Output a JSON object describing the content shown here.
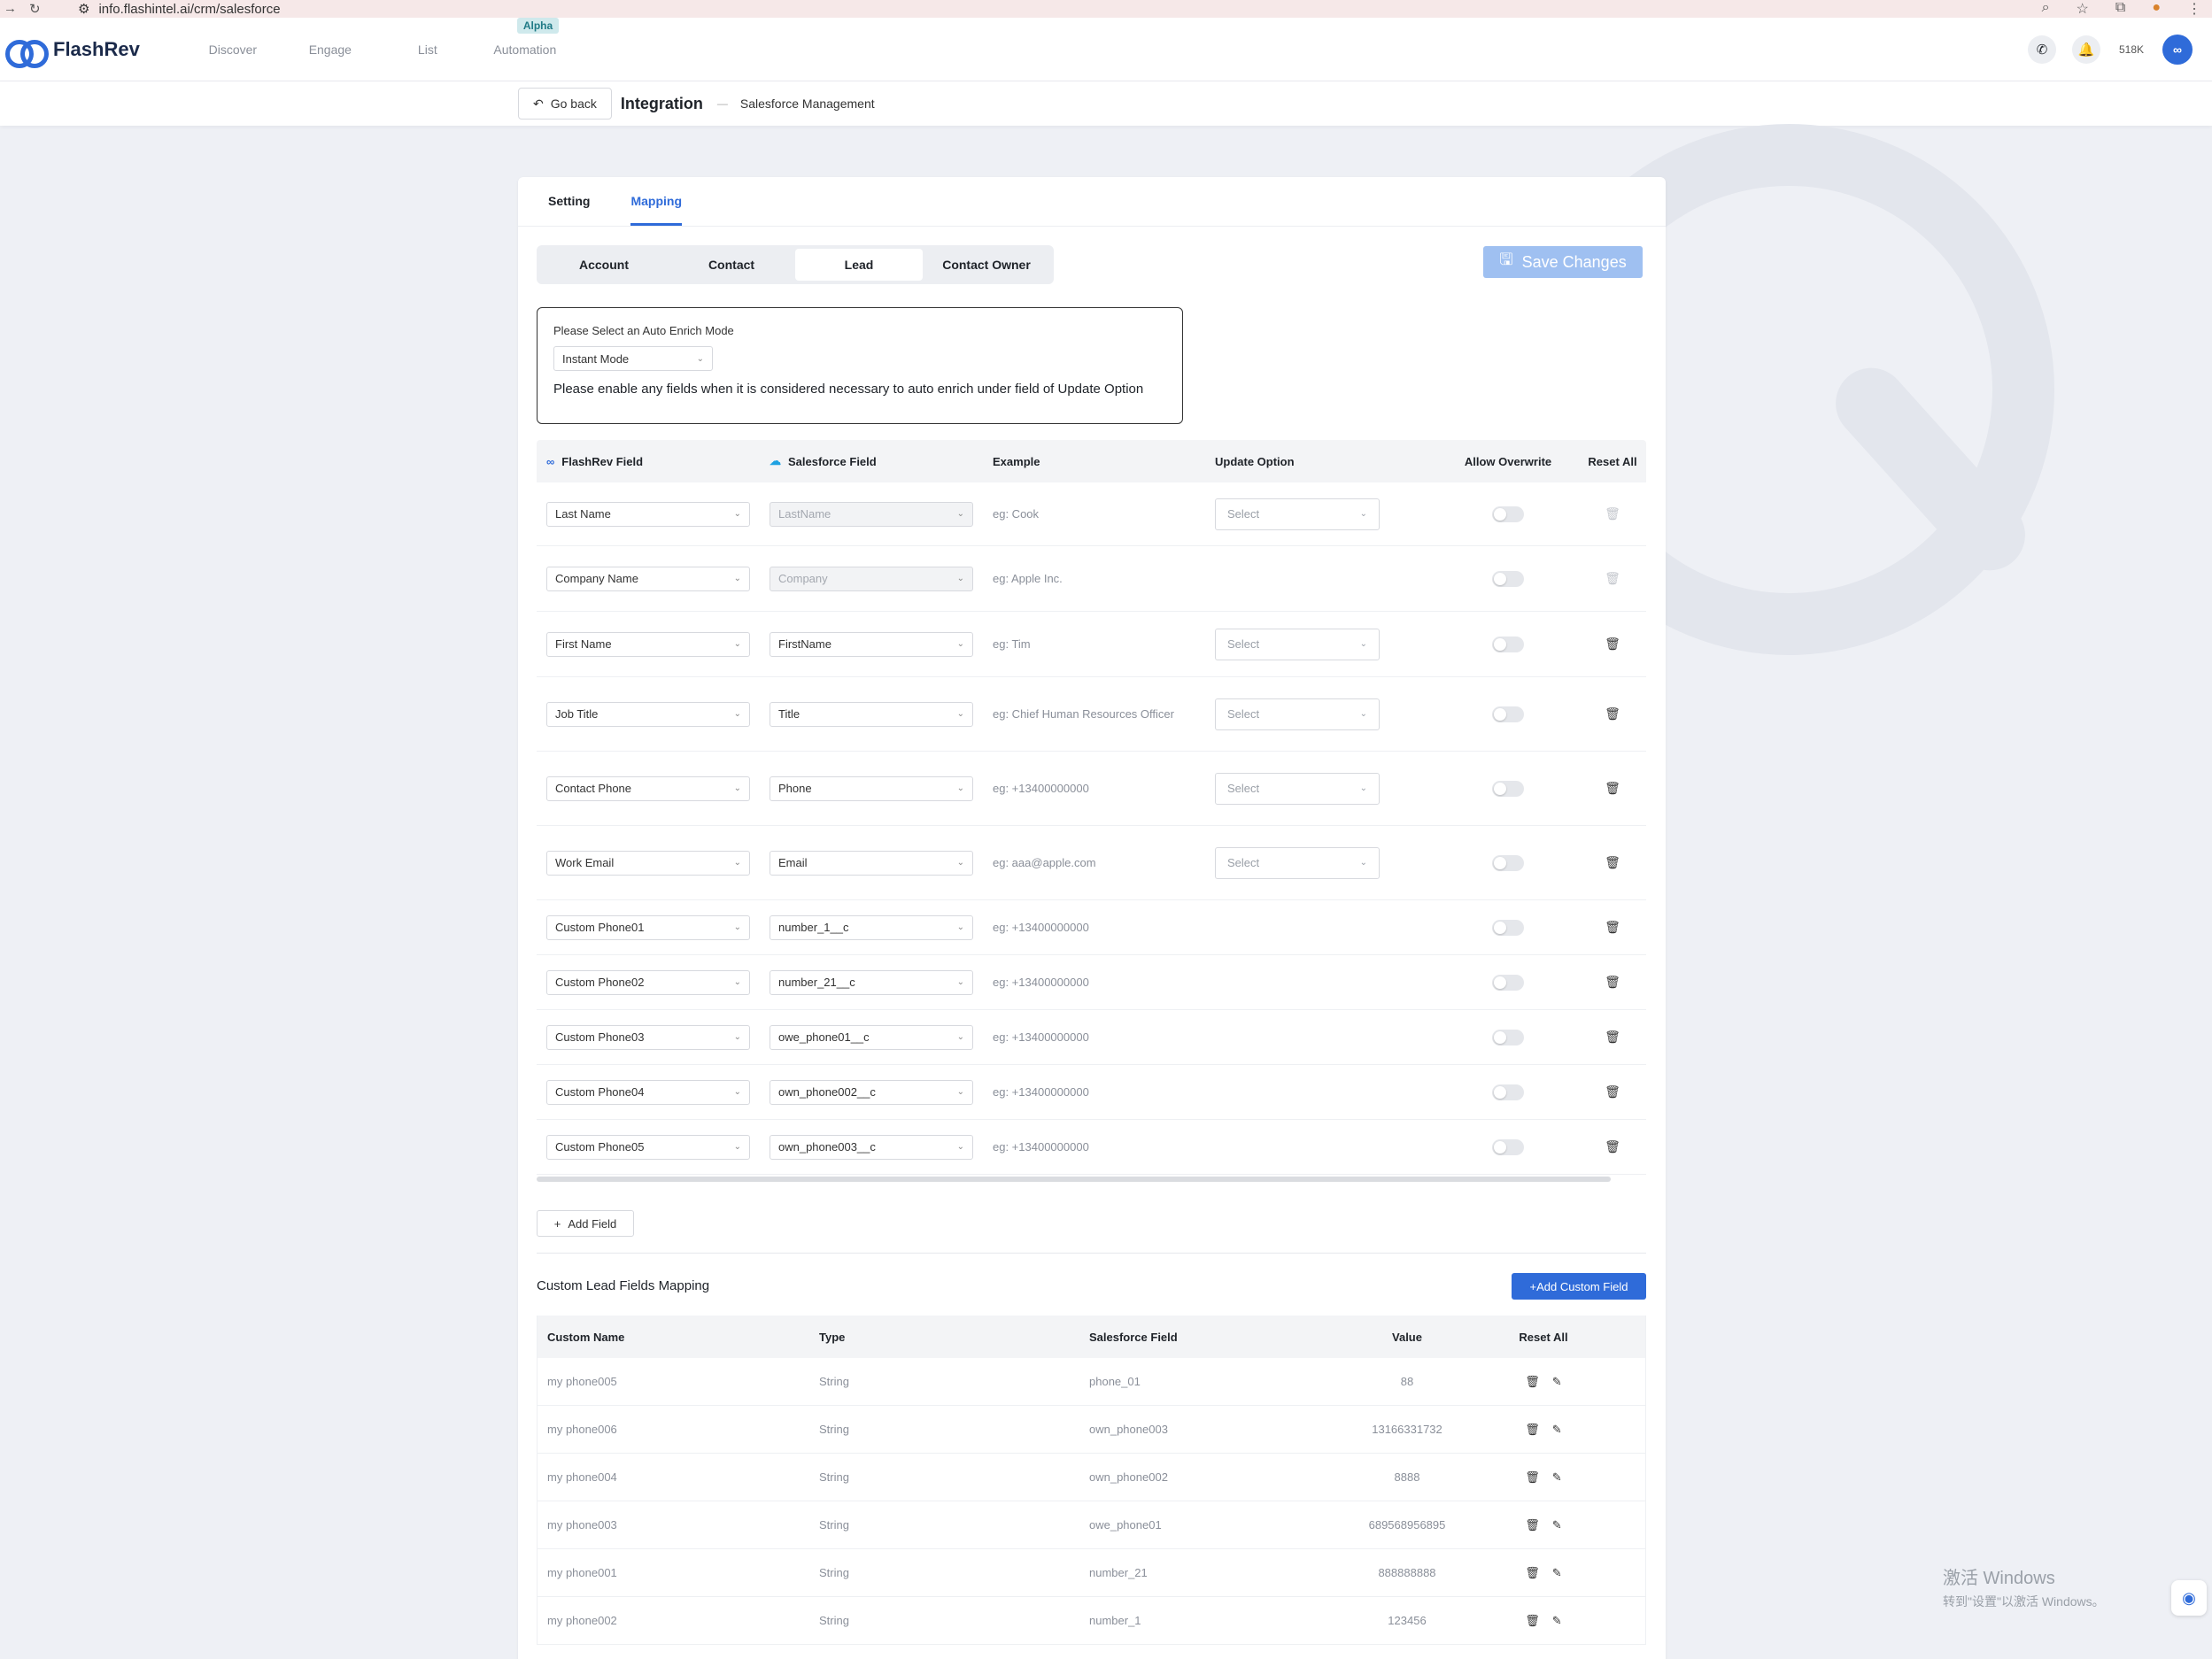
{
  "browser": {
    "url": "info.flashintel.ai/crm/salesforce"
  },
  "nav": {
    "brand": "FlashRev",
    "menu": [
      "Discover",
      "Engage",
      "List",
      "Automation"
    ],
    "alpha_badge": "Alpha",
    "credits": "518K"
  },
  "breadcrumb": {
    "go_back": "Go back",
    "title": "Integration",
    "sub": "Salesforce Management"
  },
  "tabs": [
    "Setting",
    "Mapping"
  ],
  "active_tab": "Mapping",
  "segments": [
    "Account",
    "Contact",
    "Lead",
    "Contact Owner"
  ],
  "active_segment": "Lead",
  "save_label": "Save Changes",
  "enrich": {
    "label": "Please Select an Auto Enrich Mode",
    "mode": "Instant Mode",
    "note": "Please enable any fields when it is considered necessary to auto enrich under field of Update Option"
  },
  "mapping": {
    "headers": {
      "flashrev": "FlashRev Field",
      "salesforce": "Salesforce Field",
      "example": "Example",
      "update": "Update Option",
      "overwrite": "Allow Overwrite",
      "reset": "Reset All"
    },
    "select_placeholder": "Select",
    "rows": [
      {
        "flashrev": "Last Name",
        "salesforce": "LastName",
        "example": "eg: Cook",
        "update": "Select"
      },
      {
        "flashrev": "Company Name",
        "salesforce": "Company",
        "example": "eg: Apple Inc.",
        "update": ""
      },
      {
        "flashrev": "First Name",
        "salesforce": "FirstName",
        "example": "eg: Tim",
        "update": "Select"
      },
      {
        "flashrev": "Job Title",
        "salesforce": "Title",
        "example": "eg: Chief Human Resources Officer",
        "update": "Select"
      },
      {
        "flashrev": "Contact Phone",
        "salesforce": "Phone",
        "example": "eg: +13400000000",
        "update": "Select"
      },
      {
        "flashrev": "Work Email",
        "salesforce": "Email",
        "example": "eg: aaa@apple.com",
        "update": "Select"
      },
      {
        "flashrev": "Custom Phone01",
        "salesforce": "number_1__c",
        "example": "eg: +13400000000",
        "update": ""
      },
      {
        "flashrev": "Custom Phone02",
        "salesforce": "number_21__c",
        "example": "eg: +13400000000",
        "update": ""
      },
      {
        "flashrev": "Custom Phone03",
        "salesforce": "owe_phone01__c",
        "example": "eg: +13400000000",
        "update": ""
      },
      {
        "flashrev": "Custom Phone04",
        "salesforce": "own_phone002__c",
        "example": "eg: +13400000000",
        "update": ""
      },
      {
        "flashrev": "Custom Phone05",
        "salesforce": "own_phone003__c",
        "example": "eg: +13400000000",
        "update": ""
      }
    ]
  },
  "add_field_label": "Add Field",
  "custom": {
    "title": "Custom Lead Fields Mapping",
    "add_label": "+Add Custom Field",
    "headers": {
      "name": "Custom Name",
      "type": "Type",
      "sf": "Salesforce Field",
      "value": "Value",
      "reset": "Reset All"
    },
    "rows": [
      {
        "name": "my phone005",
        "type": "String",
        "sf": "phone_01",
        "value": "88"
      },
      {
        "name": "my phone006",
        "type": "String",
        "sf": "own_phone003",
        "value": "13166331732"
      },
      {
        "name": "my phone004",
        "type": "String",
        "sf": "own_phone002",
        "value": "8888"
      },
      {
        "name": "my phone003",
        "type": "String",
        "sf": "owe_phone01",
        "value": "689568956895"
      },
      {
        "name": "my phone001",
        "type": "String",
        "sf": "number_21",
        "value": "888888888"
      },
      {
        "name": "my phone002",
        "type": "String",
        "sf": "number_1",
        "value": "123456"
      }
    ]
  },
  "windows": {
    "line1": "激活 Windows",
    "line2": "转到\"设置\"以激活 Windows。"
  }
}
